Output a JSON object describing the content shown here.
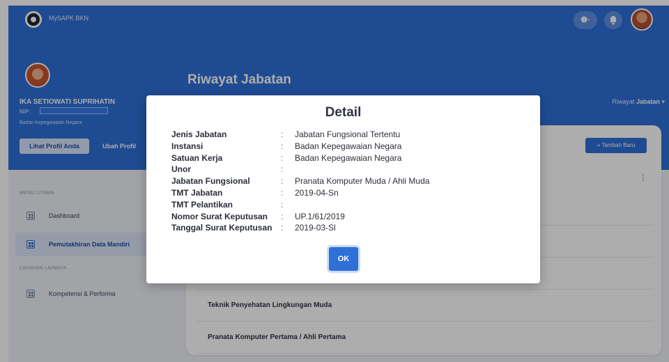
{
  "app": {
    "title": "MySAPK BKN"
  },
  "header": {
    "help_label": "❶·"
  },
  "profile": {
    "name": "IKA SETIOWATI SUPRIHATIN",
    "nip_label": "NIP:",
    "agency": "Badan Kepegawaian Negara",
    "view_profile_label": "Lihat Profil Anda",
    "edit_profile_label": "Ubah Profil"
  },
  "page": {
    "title": "Riwayat Jabatan",
    "breadcrumb_prefix": "Riwayat",
    "breadcrumb_current": "Jabatan",
    "breadcrumb_caret": "▾"
  },
  "sidebar": {
    "section_main": "MENU UTAMA",
    "section_other": "LAYANAN LAINNYA",
    "items": [
      {
        "label": "Dashboard",
        "icon": "grid-icon"
      },
      {
        "label": "Pemutakhiran Data Mandiri",
        "icon": "grid-icon",
        "active": true
      },
      {
        "label": "Kompetensi & Performa",
        "icon": "grid-icon"
      }
    ]
  },
  "main": {
    "add_button_label": "+ Tambah Baru",
    "menu_icon": "⋮",
    "rows": [
      "",
      "",
      "",
      "Teknik Penyehatan Lingkungan Muda",
      "Pranata Komputer Pertama / Ahli Pertama"
    ]
  },
  "modal": {
    "title": "Detail",
    "fields": [
      {
        "label": "Jenis Jabatan",
        "value": "Jabatan Fungsional Tertentu"
      },
      {
        "label": "Instansi",
        "value": "Badan Kepegawaian Negara"
      },
      {
        "label": "Satuan Kerja",
        "value": "Badan Kepegawaian Negara"
      },
      {
        "label": "Unor",
        "value": ""
      },
      {
        "label": "Jabatan Fungsional",
        "value": "Pranata Komputer Muda / Ahli Muda"
      },
      {
        "label": "TMT Jabatan",
        "value": "2019-04-Sn"
      },
      {
        "label": "TMT Pelantikan",
        "value": ""
      },
      {
        "label": "Nomor Surat Keputusan",
        "value": "UP.1/61/2019"
      },
      {
        "label": "Tanggal Surat Keputusan",
        "value": "2019-03-Sl"
      }
    ],
    "separator": ":",
    "ok_label": "OK"
  },
  "colors": {
    "primary": "#2f6fd8",
    "background": "#eef1f6"
  }
}
